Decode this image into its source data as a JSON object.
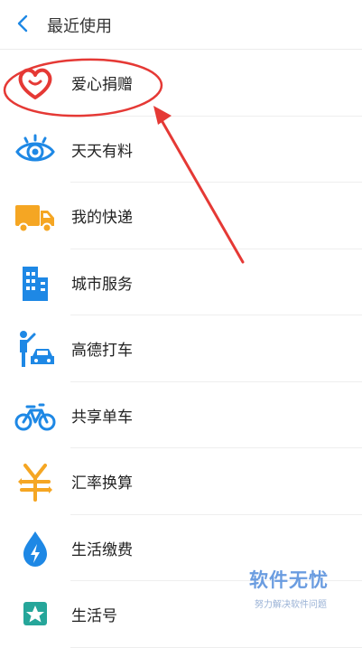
{
  "header": {
    "title": "最近使用"
  },
  "items": [
    {
      "label": "爱心捐赠",
      "icon": "heart-icon"
    },
    {
      "label": "天天有料",
      "icon": "eye-icon"
    },
    {
      "label": "我的快递",
      "icon": "delivery-truck-icon"
    },
    {
      "label": "城市服务",
      "icon": "building-icon"
    },
    {
      "label": "高德打车",
      "icon": "taxi-icon"
    },
    {
      "label": "共享单车",
      "icon": "bicycle-icon"
    },
    {
      "label": "汇率换算",
      "icon": "yen-icon"
    },
    {
      "label": "生活缴费",
      "icon": "water-drop-icon"
    },
    {
      "label": "生活号",
      "icon": "star-badge-icon"
    }
  ],
  "watermark": {
    "brand": "软件无忧",
    "slogan": "努力解决软件问题"
  },
  "colors": {
    "blue": "#1e88e5",
    "orange": "#f5a623",
    "red": "#e53935"
  }
}
